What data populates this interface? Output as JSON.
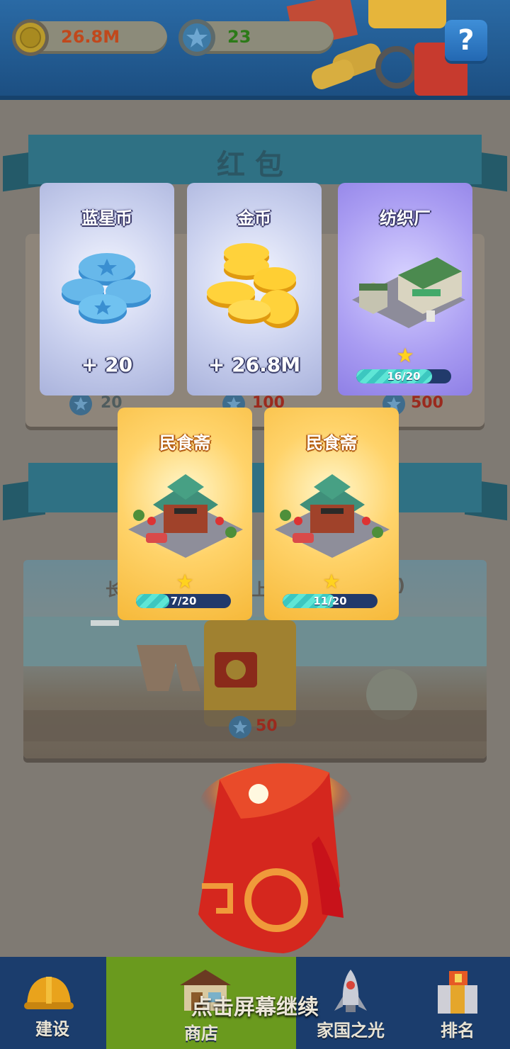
{
  "header": {
    "gold_amount": "26.8M",
    "star_amount": "23",
    "help_label": "?"
  },
  "shop": {
    "section_title": "红包",
    "prices": [
      "20",
      "100",
      "500"
    ],
    "beach_price": "50",
    "beach_fragment_left": "长",
    "beach_fragment_mid": "上",
    "beach_fragment_right": ")"
  },
  "rewards": [
    {
      "title": "蓝星币",
      "amount": "+ 20",
      "kind": "blue-star-coins"
    },
    {
      "title": "金币",
      "amount": "+ 26.8M",
      "kind": "gold-coins"
    },
    {
      "title": "纺织厂",
      "progress_text": "16/20",
      "progress": 0.8,
      "kind": "building"
    },
    {
      "title": "民食斋",
      "progress_text": "7/20",
      "progress": 0.35,
      "kind": "building"
    },
    {
      "title": "民食斋",
      "progress_text": "11/20",
      "progress": 0.55,
      "kind": "building"
    }
  ],
  "continue_hint": "点击屏幕继续",
  "nav": {
    "tabs": [
      {
        "label": "建设",
        "icon": "hard-hat-icon"
      },
      {
        "label": "商店",
        "icon": "shop-icon",
        "active": true
      },
      {
        "label": "家国之光",
        "icon": "rocket-icon"
      },
      {
        "label": "排名",
        "icon": "podium-icon"
      }
    ]
  },
  "colors": {
    "active_tab": "#6a9a1e",
    "nav_bg": "#1b3d6d",
    "gold_text": "#c0481c",
    "star_text": "#2c7a18",
    "red_packet": "#d5271e"
  }
}
